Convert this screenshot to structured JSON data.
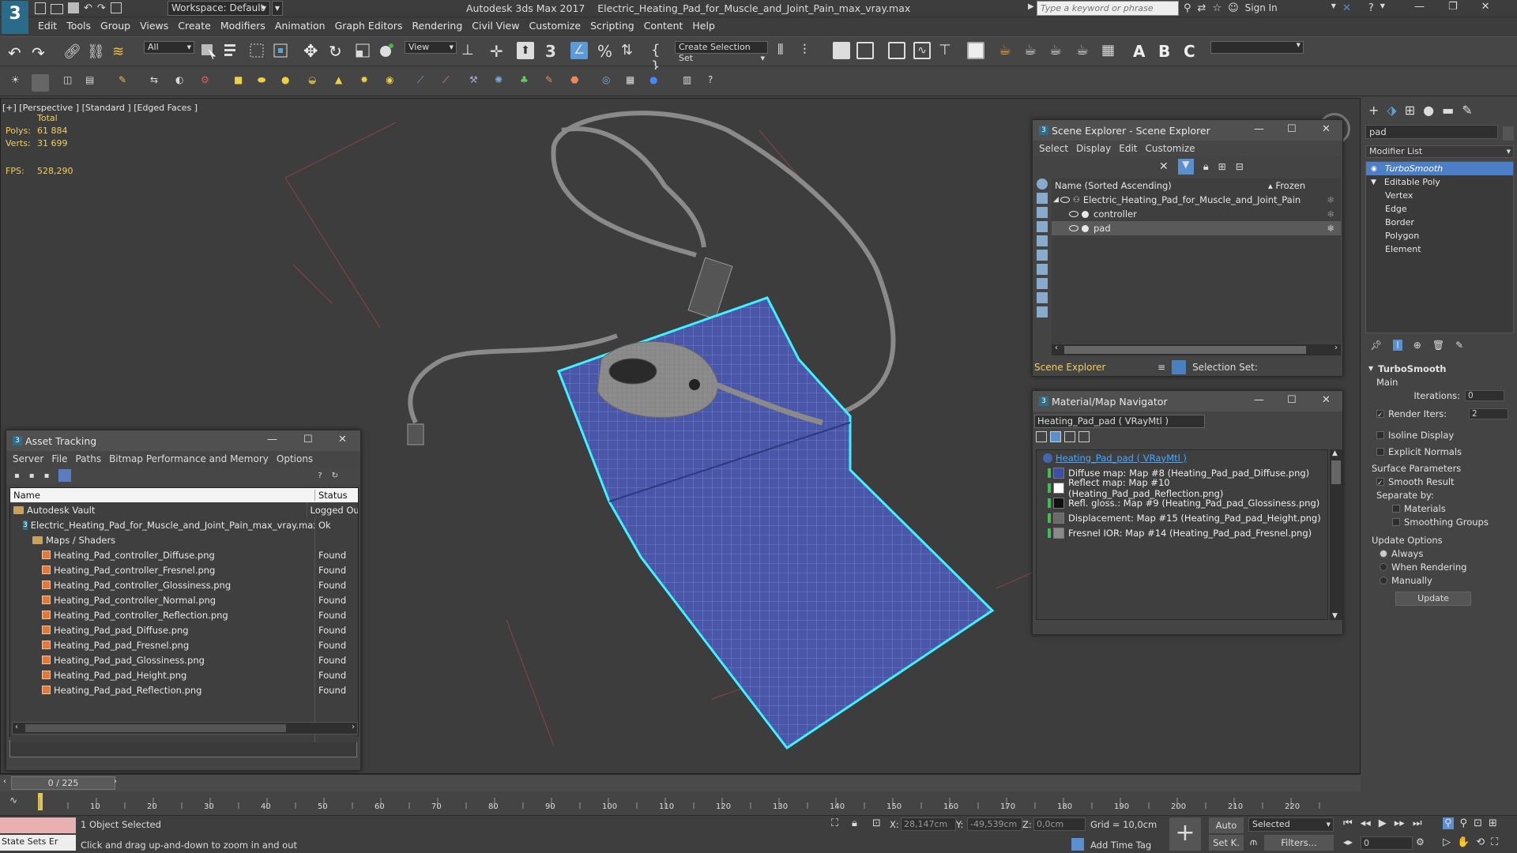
{
  "app": {
    "title": "Autodesk 3ds Max 2017",
    "file": "Electric_Heating_Pad_for_Muscle_and_Joint_Pain_max_vray.max",
    "workspace": "Workspace: Default",
    "search_placeholder": "Type a keyword or phrase",
    "sign_in": "Sign In"
  },
  "menu": [
    "Edit",
    "Tools",
    "Group",
    "Views",
    "Create",
    "Modifiers",
    "Animation",
    "Graph Editors",
    "Rendering",
    "Civil View",
    "Customize",
    "Scripting",
    "Content",
    "Help"
  ],
  "toolbar": {
    "filter": "All",
    "ref_coord": "View",
    "selection_set": "Create Selection Set"
  },
  "viewport": {
    "label": "[+] [Perspective ] [Standard ] [Edged Faces ]",
    "stats_header": "Total",
    "polys_label": "Polys:",
    "polys": "61 884",
    "verts_label": "Verts:",
    "verts": "31 699",
    "fps_label": "FPS:",
    "fps": "528,290"
  },
  "asset_tracking": {
    "title": "Asset Tracking",
    "menu": [
      "Server",
      "File",
      "Paths",
      "Bitmap Performance and Memory",
      "Options"
    ],
    "col_name": "Name",
    "col_status": "Status",
    "rows": [
      {
        "name": "Autodesk Vault",
        "status": "Logged Ou",
        "type": "vault",
        "indent": 0
      },
      {
        "name": "Electric_Heating_Pad_for_Muscle_and_Joint_Pain_max_vray.max",
        "status": "Ok",
        "type": "max",
        "indent": 1
      },
      {
        "name": "Maps / Shaders",
        "status": "",
        "type": "folder",
        "indent": 2
      },
      {
        "name": "Heating_Pad_controller_Diffuse.png",
        "status": "Found",
        "type": "png",
        "indent": 3
      },
      {
        "name": "Heating_Pad_controller_Fresnel.png",
        "status": "Found",
        "type": "png",
        "indent": 3
      },
      {
        "name": "Heating_Pad_controller_Glossiness.png",
        "status": "Found",
        "type": "png",
        "indent": 3
      },
      {
        "name": "Heating_Pad_controller_Normal.png",
        "status": "Found",
        "type": "png",
        "indent": 3
      },
      {
        "name": "Heating_Pad_controller_Reflection.png",
        "status": "Found",
        "type": "png",
        "indent": 3
      },
      {
        "name": "Heating_Pad_pad_Diffuse.png",
        "status": "Found",
        "type": "png",
        "indent": 3
      },
      {
        "name": "Heating_Pad_pad_Fresnel.png",
        "status": "Found",
        "type": "png",
        "indent": 3
      },
      {
        "name": "Heating_Pad_pad_Glossiness.png",
        "status": "Found",
        "type": "png",
        "indent": 3
      },
      {
        "name": "Heating_Pad_pad_Height.png",
        "status": "Found",
        "type": "png",
        "indent": 3
      },
      {
        "name": "Heating_Pad_pad_Reflection.png",
        "status": "Found",
        "type": "png",
        "indent": 3
      }
    ]
  },
  "scene_explorer": {
    "title": "Scene Explorer - Scene Explorer",
    "menu": [
      "Select",
      "Display",
      "Edit",
      "Customize"
    ],
    "col_name": "Name (Sorted Ascending)",
    "col_frozen": "▴ Frozen",
    "root": "Electric_Heating_Pad_for_Muscle_and_Joint_Pain",
    "children": [
      "controller",
      "pad"
    ],
    "footer_label": "Scene Explorer",
    "selection_set_label": "Selection Set:"
  },
  "material_navigator": {
    "title": "Material/Map Navigator",
    "material_field": "Heating_Pad_pad  ( VRayMtl )",
    "root": "Heating_Pad_pad  ( VRayMtl )",
    "maps": [
      {
        "label": "Diffuse map: Map #8 (Heating_Pad_pad_Diffuse.png)",
        "color": "#3b4fa8"
      },
      {
        "label": "Reflect map: Map #10 (Heating_Pad_pad_Reflection.png)",
        "color": "#ffffff"
      },
      {
        "label": "Refl. gloss.: Map #9 (Heating_Pad_pad_Glossiness.png)",
        "color": "#111111"
      },
      {
        "label": "Displacement: Map #15 (Heating_Pad_pad_Height.png)",
        "color": "#6a6a6a"
      },
      {
        "label": "Fresnel IOR: Map #14 (Heating_Pad_pad_Fresnel.png)",
        "color": "#8a8a8a"
      }
    ]
  },
  "command_panel": {
    "object_name": "pad",
    "modifier_list": "Modifier List",
    "stack": [
      {
        "label": "TurboSmooth",
        "selected": true,
        "indent": 0
      },
      {
        "label": "Editable Poly",
        "selected": false,
        "indent": 0
      },
      {
        "label": "Vertex",
        "selected": false,
        "indent": 1
      },
      {
        "label": "Edge",
        "selected": false,
        "indent": 1
      },
      {
        "label": "Border",
        "selected": false,
        "indent": 1
      },
      {
        "label": "Polygon",
        "selected": false,
        "indent": 1
      },
      {
        "label": "Element",
        "selected": false,
        "indent": 1
      }
    ],
    "rollout_title": "TurboSmooth",
    "main_label": "Main",
    "iterations_label": "Iterations:",
    "iterations": "0",
    "render_iters_label": "Render Iters:",
    "render_iters": "2",
    "isoline": "Isoline Display",
    "explicit_normals": "Explicit Normals",
    "surface_params": "Surface Parameters",
    "smooth_result": "Smooth Result",
    "separate_by": "Separate by:",
    "materials": "Materials",
    "smoothing_groups": "Smoothing Groups",
    "update_options": "Update Options",
    "always": "Always",
    "when_rendering": "When Rendering",
    "manually": "Manually",
    "update_button": "Update"
  },
  "timeline": {
    "frame": "0 / 225",
    "ticks": [
      "10",
      "20",
      "30",
      "40",
      "50",
      "60",
      "70",
      "80",
      "90",
      "100",
      "110",
      "120",
      "130",
      "140",
      "150",
      "160",
      "170",
      "180",
      "190",
      "200",
      "210",
      "220"
    ]
  },
  "status": {
    "maxscript": "State Sets Er",
    "selected": "1 Object Selected",
    "prompt": "Click and drag up-and-down to zoom in and out",
    "x_label": "X:",
    "x": "28,147cm",
    "y_label": "Y:",
    "y": "-49,539cm",
    "z_label": "Z:",
    "z": "0,0cm",
    "grid": "Grid = 10,0cm",
    "add_time_tag": "Add Time Tag",
    "auto": "Auto",
    "set_key": "Set K.",
    "key_filter": "Selected",
    "filters": "Filters...",
    "frame_field": "0"
  }
}
